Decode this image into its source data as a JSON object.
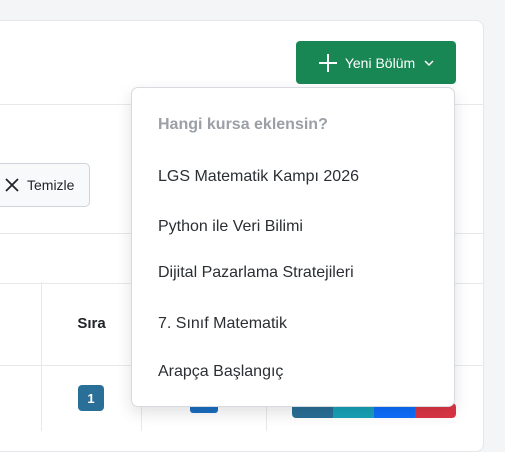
{
  "toolbar": {
    "new_section_label": "Yeni Bölüm",
    "new_section_icon": "plus-icon",
    "dropdown_icon": "chevron-down-icon",
    "clear_label": "Temizle",
    "clear_icon": "close-icon"
  },
  "table": {
    "headers": {
      "order": "Sıra"
    },
    "rows": [
      {
        "order": "1"
      }
    ]
  },
  "dropdown": {
    "header": "Hangi kursa eklensin?",
    "items": [
      "LGS Matematik Kampı 2026",
      "Python ile Veri Bilimi",
      "Dijital Pazarlama Stratejileri",
      "7. Sınıf Matematik",
      "Arapça Başlangıç"
    ]
  },
  "colors": {
    "primary": "#198754",
    "badge": "#2a6f97",
    "action_colors": [
      "#2a6f97",
      "#17a2b8",
      "#0d6efd",
      "#dc3545"
    ]
  }
}
